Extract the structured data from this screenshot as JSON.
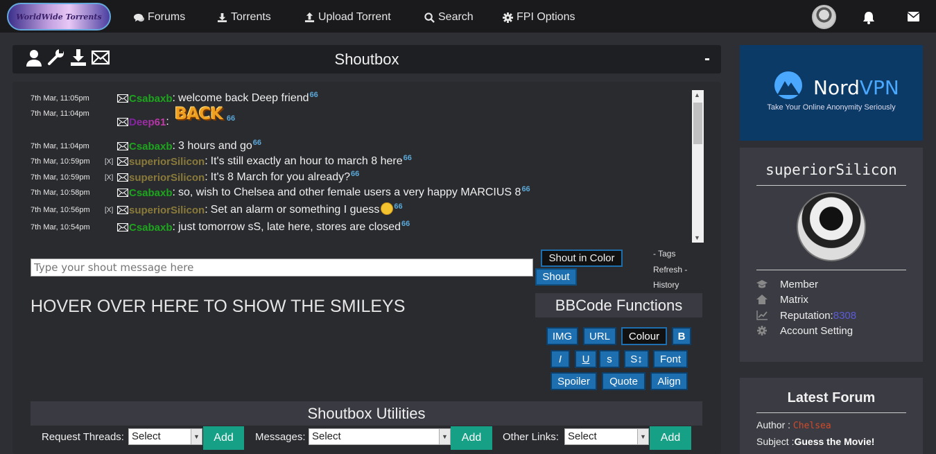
{
  "nav": {
    "logo_text": "WorldWide Torrents",
    "items": [
      {
        "label": "Forums",
        "icon": "comments-icon"
      },
      {
        "label": "Torrents",
        "icon": "download-icon"
      },
      {
        "label": "Upload Torrent",
        "icon": "upload-icon"
      },
      {
        "label": "Search",
        "icon": "search-icon"
      },
      {
        "label": "FPI Options",
        "icon": "gear-icon"
      }
    ]
  },
  "shoutbox": {
    "title": "Shoutbox",
    "collapse": "-",
    "messages": [
      {
        "time": "7th Mar, 11:05pm",
        "del": "",
        "user": "Csabaxb",
        "text": "welcome back Deep friend"
      },
      {
        "time": "7th Mar, 11:04pm",
        "del": "",
        "user": "Deep61",
        "text": "BACK"
      },
      {
        "time": "7th Mar, 11:04pm",
        "del": "",
        "user": "Csabaxb",
        "text": "3 hours and go"
      },
      {
        "time": "7th Mar, 10:59pm",
        "del": "[X]",
        "user": "superiorSilicon",
        "text": "It's still exactly an hour to march 8 here"
      },
      {
        "time": "7th Mar, 10:59pm",
        "del": "[X]",
        "user": "superiorSilicon",
        "text": "It's 8 March for you already?"
      },
      {
        "time": "7th Mar, 10:58pm",
        "del": "",
        "user": "Csabaxb",
        "text": "so, wish to Chelsea and other female users a very happy MARCIUS 8"
      },
      {
        "time": "7th Mar, 10:56pm",
        "del": "[X]",
        "user": "superiorSilicon",
        "text": "Set an alarm or something I guess"
      },
      {
        "time": "7th Mar, 10:54pm",
        "del": "",
        "user": "Csabaxb",
        "text": "just tomorrow sS, late here, stores are closed"
      }
    ],
    "quote_mark": "66",
    "input_placeholder": "Type your shout message here",
    "shout_color_btn": "Shout in Color",
    "shout_btn": "Shout",
    "links": {
      "tags": "- Tags",
      "refresh": "Refresh -",
      "history": "History"
    },
    "smileys_hover": "HOVER OVER HERE TO SHOW THE SMILEYS"
  },
  "bbcode": {
    "title": "BBCode Functions",
    "row1": [
      "IMG",
      "URL",
      "Colour",
      "B"
    ],
    "row2": [
      "I",
      "U",
      "s",
      "S↕",
      "Font"
    ],
    "row3": [
      "Spoiler",
      "Quote",
      "Align"
    ]
  },
  "utilities": {
    "title": "Shoutbox Utilities",
    "groups": [
      {
        "label": "Request Threads:",
        "select": "Select",
        "add": "Add"
      },
      {
        "label": "Messages:",
        "select": "Select",
        "add": "Add"
      },
      {
        "label": "Other Links:",
        "select": "Select",
        "add": "Add"
      }
    ]
  },
  "ad": {
    "brand1": "Nord",
    "brand2": "VPN",
    "tagline": "Take Your Online Anonymity Seriously"
  },
  "profile": {
    "username": "superiorSilicon",
    "items": {
      "member": "Member",
      "matrix": "Matrix",
      "reputation_label": "Reputation: ",
      "reputation_value": "8308",
      "account": "Account Setting"
    }
  },
  "latest_forum": {
    "title": "Latest Forum",
    "author_label": "Author : ",
    "author": "Chelsea",
    "subject_label": "Subject :",
    "subject": "Guess the Movie!"
  }
}
